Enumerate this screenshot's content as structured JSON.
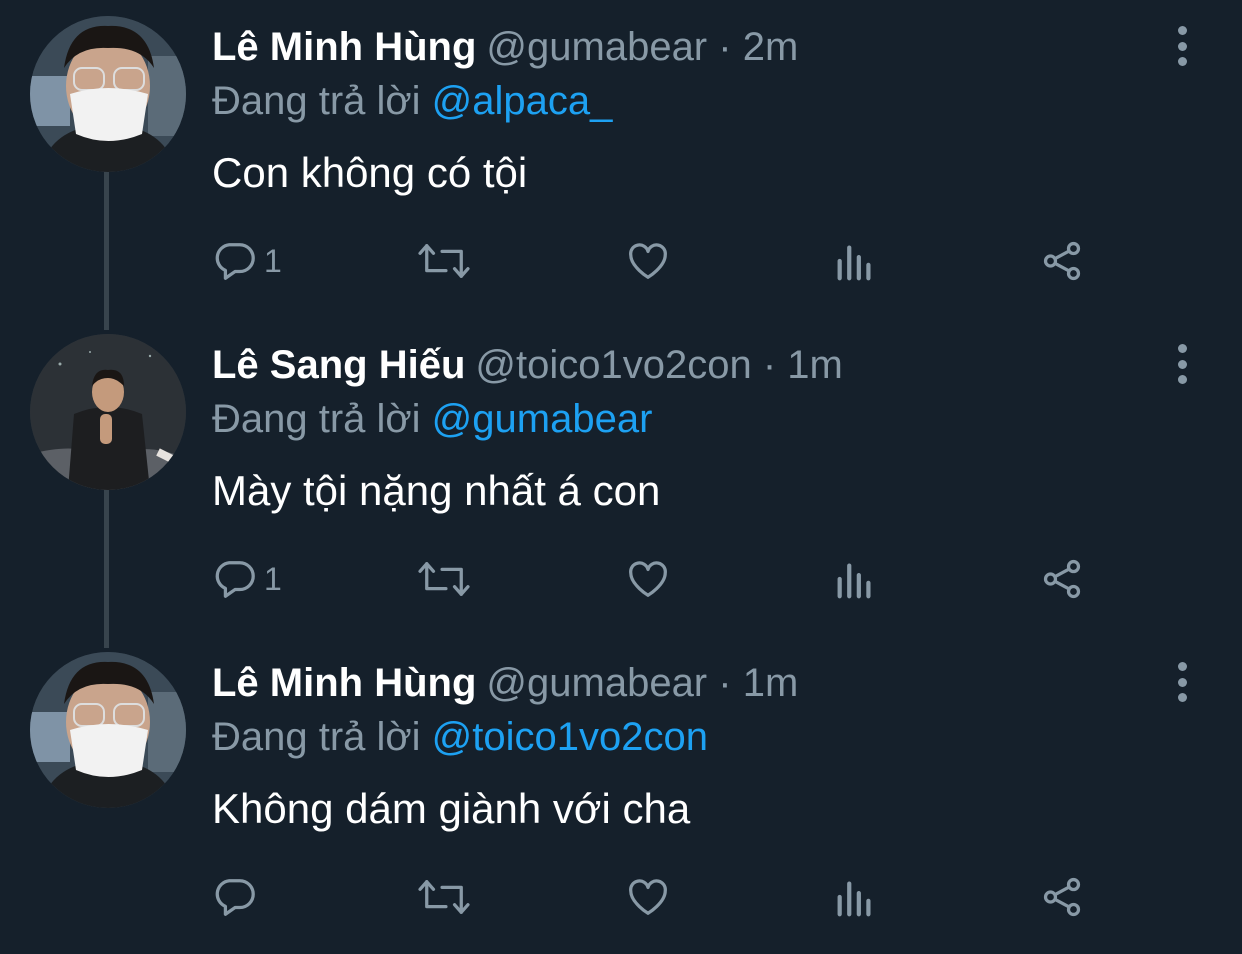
{
  "tweets": [
    {
      "name": "Lê Minh Hùng",
      "handle": "@gumabear",
      "separator": "·",
      "time": "2m",
      "replying_prefix": "Đang trả lời",
      "replying_to": "@alpaca_",
      "text": "Con không có tội",
      "reply_count": "1",
      "avatar_icon": "avatar-masked-man"
    },
    {
      "name": "Lê Sang Hiếu",
      "handle": "@toico1vo2con",
      "separator": "·",
      "time": "1m",
      "replying_prefix": "Đang trả lời",
      "replying_to": "@gumabear",
      "text": "Mày tội nặng nhất á con",
      "reply_count": "1",
      "avatar_icon": "avatar-thumbs-up-man"
    },
    {
      "name": "Lê Minh Hùng",
      "handle": "@gumabear",
      "separator": "·",
      "time": "1m",
      "replying_prefix": "Đang trả lời",
      "replying_to": "@toico1vo2con",
      "text": "Không dám giành với cha",
      "reply_count": "",
      "avatar_icon": "avatar-masked-man"
    }
  ],
  "colors": {
    "background": "#15202b",
    "secondary_text": "#8899a6",
    "link": "#1da1f2",
    "thread_line": "#38444d"
  },
  "icons": [
    "reply-icon",
    "retweet-icon",
    "like-icon",
    "stats-icon",
    "share-icon",
    "more-icon"
  ]
}
